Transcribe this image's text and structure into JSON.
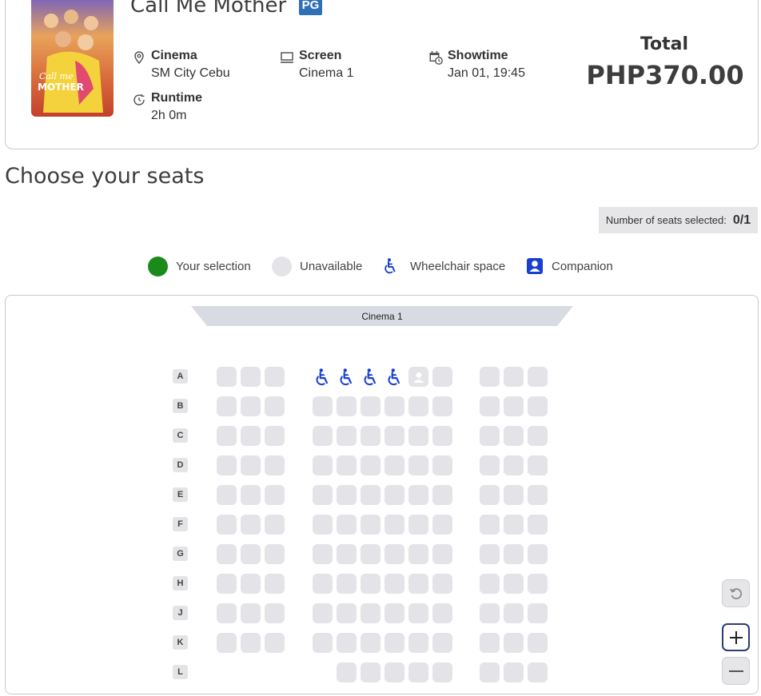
{
  "movie": {
    "title": "Call Me Mother",
    "rating": "PG",
    "poster_text": "Call me MOTHER"
  },
  "details": {
    "cinema": {
      "label": "Cinema",
      "value": "SM City Cebu"
    },
    "screen": {
      "label": "Screen",
      "value": "Cinema 1"
    },
    "showtime": {
      "label": "Showtime",
      "value": "Jan 01, 19:45"
    },
    "runtime": {
      "label": "Runtime",
      "value": "2h 0m"
    }
  },
  "total": {
    "label": "Total",
    "value": "PHP370.00"
  },
  "section_title": "Choose your seats",
  "seat_count": {
    "label": "Number of seats selected:",
    "value": "0/1"
  },
  "legend": {
    "selection": "Your selection",
    "unavailable": "Unavailable",
    "wheelchair": "Wheelchair space",
    "companion": "Companion"
  },
  "colors": {
    "selection": "#1a8a1a",
    "unavailable": "#e4e4e8",
    "wheelchair": "#1a3fcf",
    "companion": "#1a3fcf",
    "rating": "#2f6fb7"
  },
  "seatmap": {
    "screen_label": "Cinema 1",
    "rows": [
      "A",
      "B",
      "C",
      "D",
      "E",
      "F",
      "G",
      "H",
      "J",
      "K",
      "L"
    ],
    "row_a_special": {
      "wheelchair_seats": 4,
      "companion_seats": 1
    }
  },
  "icons": {
    "cinema": "location-pin-icon",
    "screen": "monitor-icon",
    "showtime": "calendar-clock-icon",
    "runtime": "clock-icon",
    "reset": "reset-icon",
    "zoom_in": "plus-icon",
    "zoom_out": "minus-icon"
  }
}
